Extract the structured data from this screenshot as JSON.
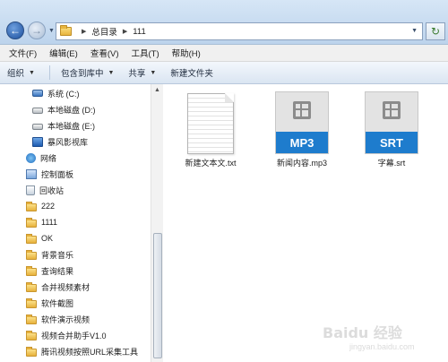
{
  "address_bar": {
    "path": [
      "总目录",
      "111"
    ]
  },
  "menu": [
    "文件(F)",
    "编辑(E)",
    "查看(V)",
    "工具(T)",
    "帮助(H)"
  ],
  "command_bar": {
    "organize": "组织",
    "include_in_library": "包含到库中",
    "share": "共享",
    "new_folder": "新建文件夹"
  },
  "nav_pane": {
    "items": [
      {
        "label": "系统 (C:)",
        "icon": "system-drive-icon"
      },
      {
        "label": "本地磁盘 (D:)",
        "icon": "drive-icon"
      },
      {
        "label": "本地磁盘 (E:)",
        "icon": "drive-icon"
      },
      {
        "label": "暴风影视库",
        "icon": "video-library-icon"
      },
      {
        "label": "网络",
        "icon": "network-icon"
      },
      {
        "label": "控制面板",
        "icon": "control-panel-icon"
      },
      {
        "label": "回收站",
        "icon": "recycle-bin-icon"
      },
      {
        "label": "222",
        "icon": "folder-icon"
      },
      {
        "label": "1111",
        "icon": "folder-icon"
      },
      {
        "label": "OK",
        "icon": "folder-icon"
      },
      {
        "label": "背景音乐",
        "icon": "folder-icon"
      },
      {
        "label": "查询结果",
        "icon": "folder-icon"
      },
      {
        "label": "合并视频素材",
        "icon": "folder-icon"
      },
      {
        "label": "软件截图",
        "icon": "folder-icon"
      },
      {
        "label": "软件演示视频",
        "icon": "folder-icon"
      },
      {
        "label": "视频合并助手V1.0",
        "icon": "folder-icon"
      },
      {
        "label": "腾讯视频按照URL采集工具",
        "icon": "folder-icon"
      }
    ]
  },
  "files": [
    {
      "name": "新建文本文.txt",
      "type": "txt",
      "badge": ""
    },
    {
      "name": "新闻内容.mp3",
      "type": "media",
      "badge": "MP3"
    },
    {
      "name": "字幕.srt",
      "type": "media",
      "badge": "SRT"
    }
  ],
  "watermark": {
    "main": "Baidu 经验",
    "sub": "jingyan.baidu.com"
  }
}
